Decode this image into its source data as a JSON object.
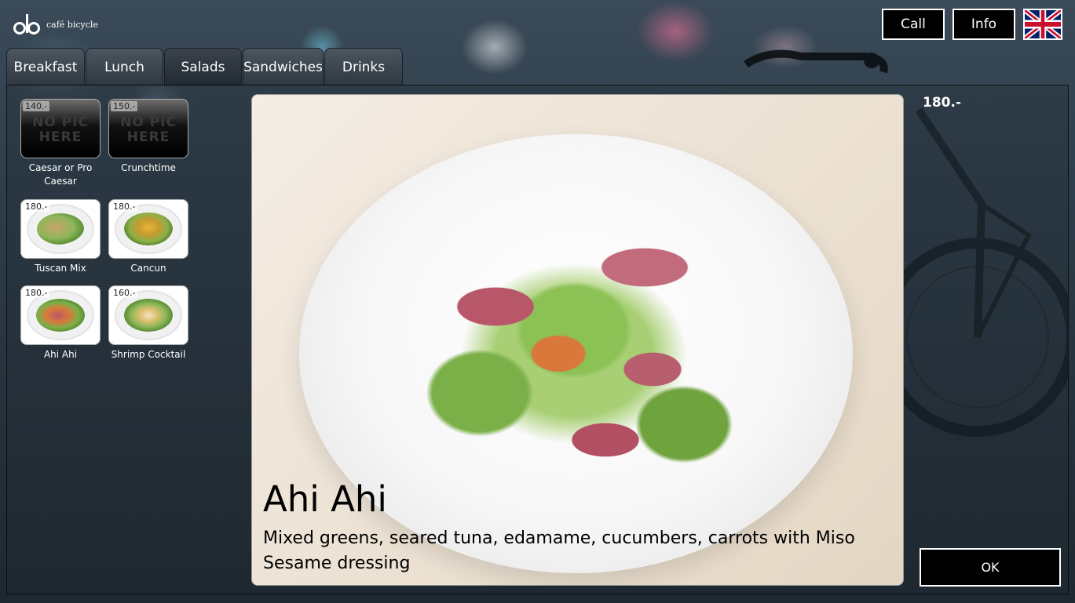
{
  "brand": {
    "name": "café bicycle"
  },
  "header": {
    "call_label": "Call",
    "info_label": "Info",
    "language_flag": "uk-flag-icon"
  },
  "tabs": [
    {
      "label": "Breakfast"
    },
    {
      "label": "Lunch"
    },
    {
      "label": "Salads"
    },
    {
      "label": "Sandwiches"
    },
    {
      "label": "Drinks"
    }
  ],
  "menu_items": [
    {
      "price": "140.-",
      "name": "Caesar or Pro Caesar",
      "image": "NO PIC HERE"
    },
    {
      "price": "150.-",
      "name": "Crunchtime",
      "image": "NO PIC HERE"
    },
    {
      "price": "180.-",
      "name": "Tuscan Mix"
    },
    {
      "price": "180.-",
      "name": "Cancun"
    },
    {
      "price": "180.-",
      "name": "Ahi Ahi"
    },
    {
      "price": "160.-",
      "name": "Shrimp Cocktail"
    }
  ],
  "detail": {
    "price": "180.-",
    "title": "Ahi Ahi",
    "description": "Mixed greens, seared tuna, edamame, cucumbers, carrots with Miso Sesame dressing",
    "ok_label": "OK"
  }
}
